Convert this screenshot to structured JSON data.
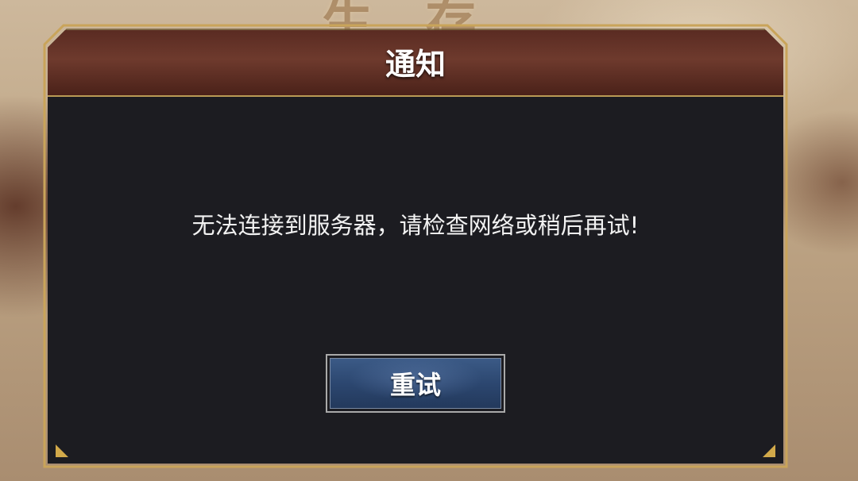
{
  "background": {
    "title_fragment": "生 存"
  },
  "dialog": {
    "title": "通知",
    "message": "无法连接到服务器，请检查网络或稍后再试!",
    "retry_button_label": "重试"
  },
  "colors": {
    "frame_gold": "#c9a45a",
    "title_bar": "#6e3a2d",
    "dialog_bg": "#1c1c21",
    "button_blue": "#2c4770",
    "text": "#ffffff"
  }
}
